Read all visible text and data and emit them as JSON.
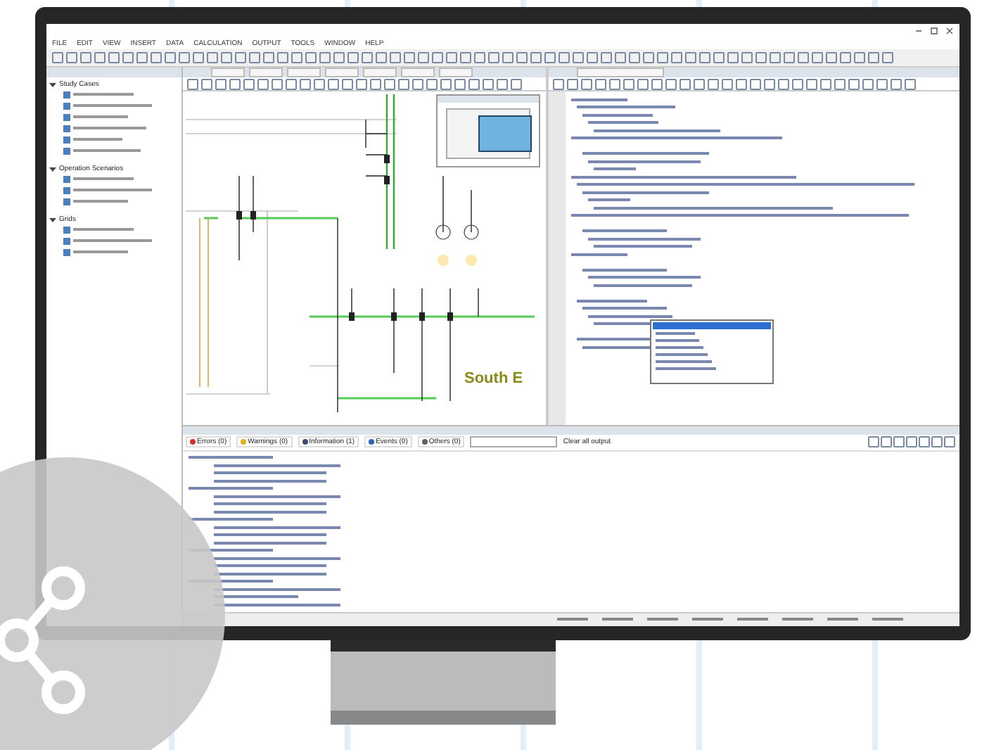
{
  "menu": [
    "FILE",
    "EDIT",
    "VIEW",
    "INSERT",
    "DATA",
    "CALCULATION",
    "OUTPUT",
    "TOOLS",
    "WINDOW",
    "HELP"
  ],
  "tree": {
    "sections": [
      {
        "title": "Study Cases",
        "expanded": true
      },
      {
        "title": "Operation Scenarios",
        "expanded": true
      },
      {
        "title": "Grids",
        "expanded": true
      }
    ]
  },
  "diagram": {
    "area_label": "South E"
  },
  "output": {
    "tabs": [
      {
        "label": "Errors (0)",
        "kind": "error"
      },
      {
        "label": "Warnings (0)",
        "kind": "warning"
      },
      {
        "label": "Information (1)",
        "kind": "info"
      },
      {
        "label": "Events (0)",
        "kind": "event"
      },
      {
        "label": "Others (0)",
        "kind": "other"
      }
    ],
    "clear_label": "Clear all output"
  }
}
